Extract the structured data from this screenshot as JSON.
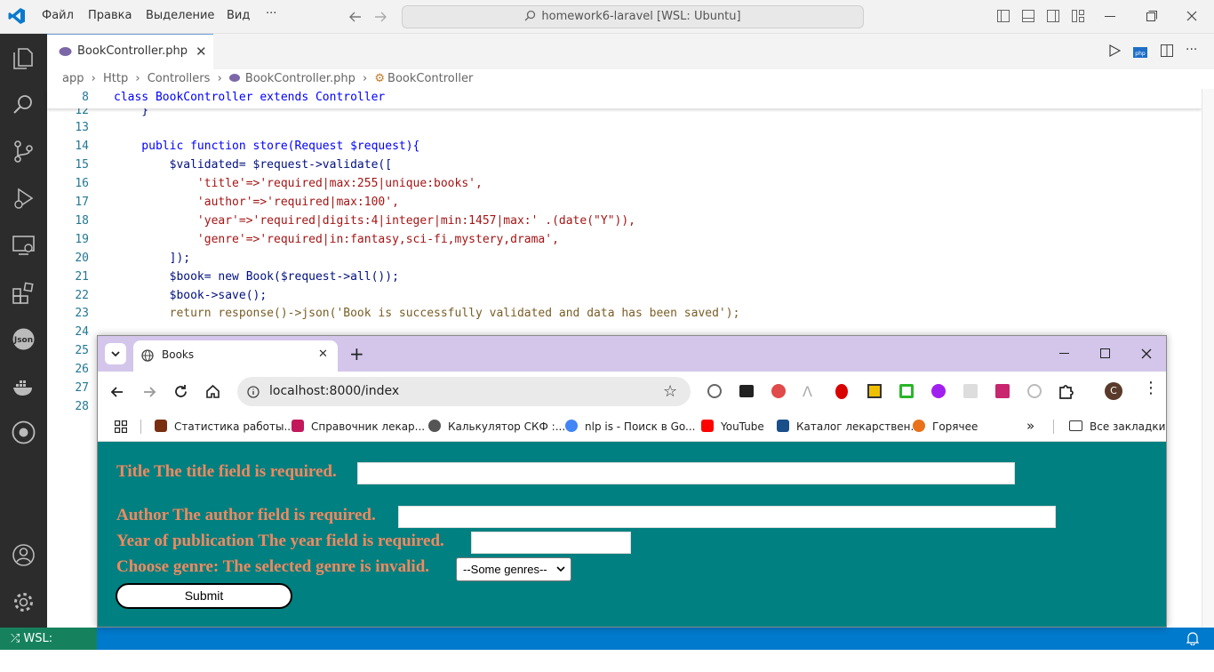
{
  "vscode": {
    "menu": [
      "Файл",
      "Правка",
      "Выделение",
      "Вид",
      "···"
    ],
    "command_center": "homework6-laravel [WSL: Ubuntu]",
    "tab": "BookController.php",
    "breadcrumb": [
      "app",
      "Http",
      "Controllers",
      "BookController.php",
      "BookController"
    ],
    "sticky": {
      "num": "8",
      "code": "class BookController extends Controller"
    },
    "lines": [
      {
        "num": "12",
        "text": "    }"
      },
      {
        "num": "13",
        "text": ""
      },
      {
        "num": "14",
        "text": "    public function store(Request $request){"
      },
      {
        "num": "15",
        "text": "        $validated= $request->validate(["
      },
      {
        "num": "16",
        "text": "            'title'=>'required|max:255|unique:books',"
      },
      {
        "num": "17",
        "text": "            'author'=>'required|max:100',"
      },
      {
        "num": "18",
        "text": "            'year'=>'required|digits:4|integer|min:1457|max:' .(date(\"Y\")),"
      },
      {
        "num": "19",
        "text": "            'genre'=>'required|in:fantasy,sci-fi,mystery,drama',"
      },
      {
        "num": "20",
        "text": "        ]);"
      },
      {
        "num": "21",
        "text": "        $book= new Book($request->all());"
      },
      {
        "num": "22",
        "text": "        $book->save();"
      },
      {
        "num": "23",
        "text": "        return response()->json('Book is successfully validated and data has been saved');"
      },
      {
        "num": "24",
        "text": ""
      },
      {
        "num": "25",
        "text": ""
      },
      {
        "num": "26",
        "text": ""
      },
      {
        "num": "27",
        "text": ""
      },
      {
        "num": "28",
        "text": ""
      }
    ],
    "status_remote": "WSL: Ubuntu"
  },
  "chrome": {
    "tab_title": "Books",
    "url": "localhost:8000/index",
    "bookmarks": [
      {
        "label": "Статистика работы...",
        "color": "#7a2e10"
      },
      {
        "label": "Справочник лекар...",
        "color": "#c2185b"
      },
      {
        "label": "Калькулятор СКФ :...",
        "color": "#555555"
      },
      {
        "label": "nlp is - Поиск в Go...",
        "color": "#4285f4"
      },
      {
        "label": "YouTube",
        "color": "#ff0000"
      },
      {
        "label": "Каталог лекарствен...",
        "color": "#1a4f8a"
      },
      {
        "label": "Горячее",
        "color": "#e8711a"
      }
    ],
    "all_bookmarks": "Все закладки",
    "profile_letter": "C",
    "form": {
      "title_label": "Title The title field is required.",
      "author_label": "Author The author field is required.",
      "year_label": "Year of publication The year field is required.",
      "genre_label": "Choose genre: The selected genre is invalid.",
      "genre_selected": "--Some genres--",
      "submit": "Submit"
    }
  },
  "colors": {
    "page_bg": "#008080",
    "label": "#f3885f",
    "vscode_status": "#007acc",
    "chrome_tabstrip": "#d3c6ea"
  }
}
